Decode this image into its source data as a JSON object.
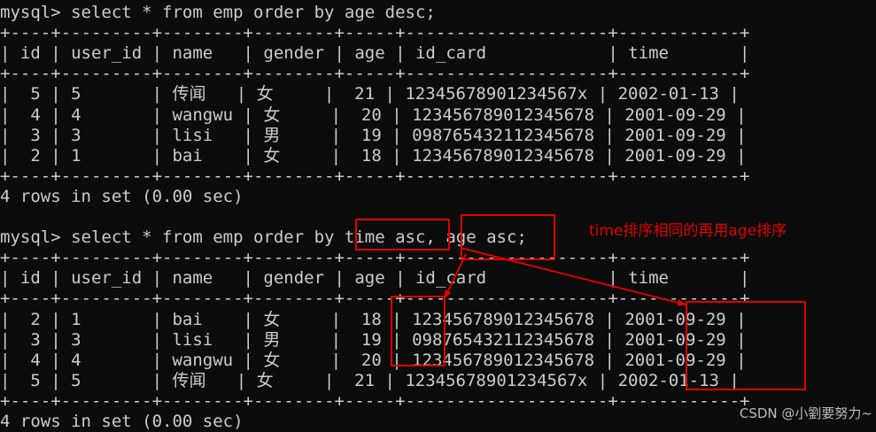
{
  "terminal": {
    "lines": [
      "mysql> select * from emp order by age desc;",
      "+----+---------+--------+--------+-----+--------------------+------------+",
      "| id | user_id | name   | gender | age | id_card            | time       |",
      "+----+---------+--------+--------+-----+--------------------+------------+",
      "|  5 | 5       | 传闻   | 女     |  21 | 12345678901234567x | 2002-01-13 |",
      "|  4 | 4       | wangwu | 女     |  20 | 123456789012345678 | 2001-09-29 |",
      "|  3 | 3       | lisi   | 男     |  19 | 098765432112345678 | 2001-09-29 |",
      "|  2 | 1       | bai    | 女     |  18 | 123456789012345678 | 2001-09-29 |",
      "+----+---------+--------+--------+-----+--------------------+------------+",
      "4 rows in set (0.00 sec)",
      "",
      "mysql> select * from emp order by time asc, age asc;",
      "+----+---------+--------+--------+-----+--------------------+------------+",
      "| id | user_id | name   | gender | age | id_card            | time       |",
      "+----+---------+--------+--------+-----+--------------------+------------+",
      "|  2 | 1       | bai    | 女     |  18 | 123456789012345678 | 2001-09-29 |",
      "|  3 | 3       | lisi   | 男     |  19 | 098765432112345678 | 2001-09-29 |",
      "|  4 | 4       | wangwu | 女     |  20 | 123456789012345678 | 2001-09-29 |",
      "|  5 | 5       | 传闻   | 女     |  21 | 12345678901234567x | 2002-01-13 |",
      "+----+---------+--------+--------+-----+--------------------+------------+",
      "4 rows in set (0.00 sec)"
    ]
  },
  "annotation": {
    "note": "time排序相同的再用age排序",
    "color": "#e00000"
  },
  "watermark": "CSDN @小劉要努力~",
  "colors": {
    "background": "#0c0c0c",
    "text": "#cccccc"
  }
}
